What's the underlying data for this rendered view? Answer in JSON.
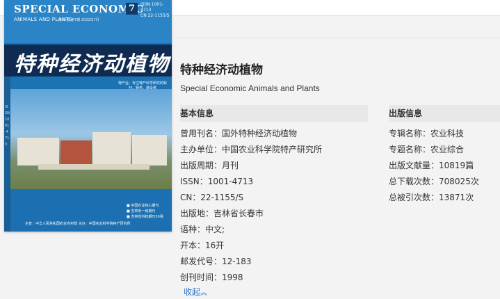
{
  "cover": {
    "title_en_line1": "SPECIAL ECONOMIC",
    "title_en_line2": "ANIMALS AND PLANTS",
    "issue_line": "第25卷 第7期 2022年7月",
    "issue_number": "7",
    "issn": "ISSN 1001-4713",
    "cn": "CN 22-1155/S",
    "title_cn": "特种经济动植物",
    "tagline": "特产业、专注特产科学研究的科刊、服务、建设者",
    "strip_text": "ISSN 1001-4713",
    "badges": [
      "中国农业核心期刊",
      "吉林省一级期刊",
      "吉林省科技期刊30强"
    ],
    "footer": "主管：中华人民共和国农业农村部    主办：中国农业科学院特产研究所"
  },
  "journal": {
    "title_cn": "特种经济动植物",
    "title_en": "Special Economic Animals and Plants"
  },
  "basic_info": {
    "heading": "基本信息",
    "fields": [
      {
        "label": "曾用刊名：",
        "value": "国外特种经济动植物"
      },
      {
        "label": "主办单位：",
        "value": "中国农业科学院特产研究所"
      },
      {
        "label": "出版周期：",
        "value": "月刊"
      },
      {
        "label": "ISSN：",
        "value": "1001-4713"
      },
      {
        "label": "CN：",
        "value": "22-1155/S"
      },
      {
        "label": "出版地：",
        "value": "吉林省长春市"
      },
      {
        "label": "语种：",
        "value": "中文;"
      },
      {
        "label": "开本：",
        "value": "16开"
      },
      {
        "label": "邮发代号：",
        "value": "12-183"
      },
      {
        "label": "创刊时间：",
        "value": "1998"
      }
    ],
    "collapse_label": "收起"
  },
  "pub_info": {
    "heading": "出版信息",
    "fields": [
      {
        "label": "专辑名称：",
        "value": "农业科技"
      },
      {
        "label": "专题名称：",
        "value": "农业综合"
      },
      {
        "label": "出版文献量：",
        "value": "10819篇"
      },
      {
        "label": "总下载次数：",
        "value": "708025次"
      },
      {
        "label": "总被引次数：",
        "value": "13871次"
      }
    ]
  },
  "colors": {
    "accent_link": "#2a6fc4",
    "cover_blue": "#1c73b4",
    "cover_title_band": "#0f2b52"
  }
}
